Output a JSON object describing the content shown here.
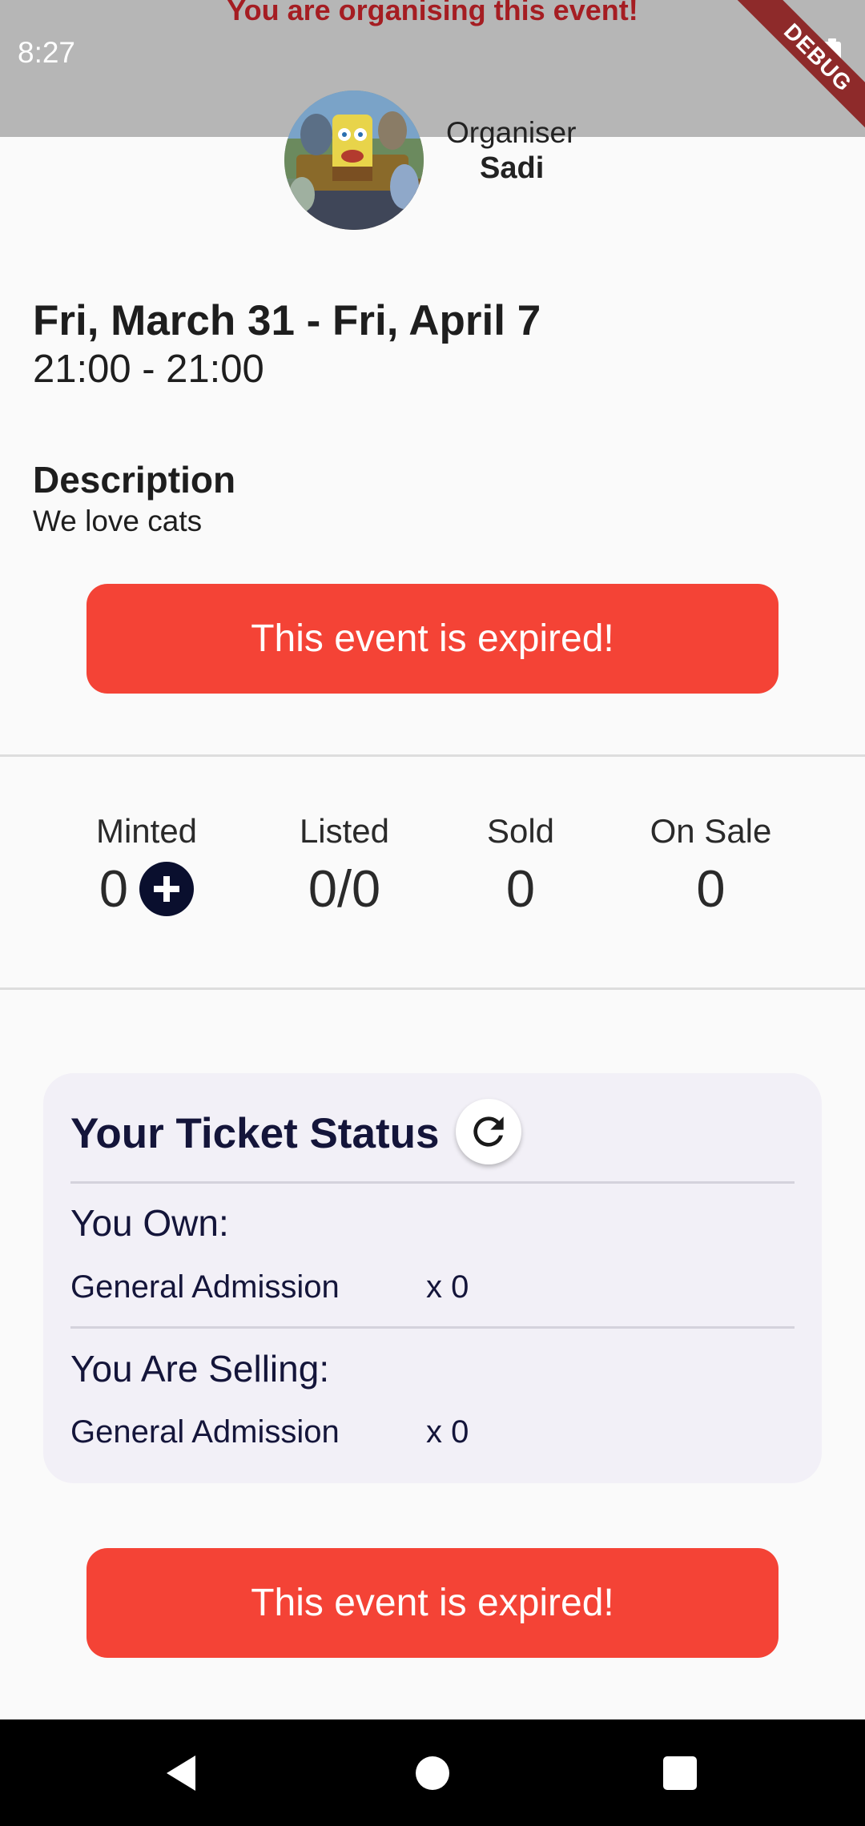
{
  "status_bar": {
    "time": "8:27",
    "battery_icon": "battery-full-icon"
  },
  "banner": {
    "text": "You are organising this event!",
    "color": "#a51d22"
  },
  "debug_ribbon": {
    "label": "DEBUG"
  },
  "organiser": {
    "label": "Organiser",
    "name": "Sadi"
  },
  "event": {
    "date_range": "Fri, March 31 - Fri, April 7",
    "time_range": "21:00 - 21:00",
    "description_heading": "Description",
    "description": "We love cats"
  },
  "expired_button": {
    "label": "This event is expired!",
    "color": "#f44336"
  },
  "stats": {
    "minted": {
      "label": "Minted",
      "value": "0",
      "add_icon": "plus-icon"
    },
    "listed": {
      "label": "Listed",
      "value": "0/0"
    },
    "sold": {
      "label": "Sold",
      "value": "0"
    },
    "on_sale": {
      "label": "On Sale",
      "value": "0"
    }
  },
  "ticket_status": {
    "title": "Your Ticket Status",
    "refresh_icon": "refresh-icon",
    "own_label": "You Own:",
    "own_items": [
      {
        "type": "General Admission",
        "count": "x 0"
      }
    ],
    "selling_label": "You Are Selling:",
    "selling_items": [
      {
        "type": "General Admission",
        "count": "x 0"
      }
    ]
  },
  "nav_bar": {
    "back_icon": "back-triangle-icon",
    "home_icon": "home-circle-icon",
    "recents_icon": "recents-square-icon"
  }
}
